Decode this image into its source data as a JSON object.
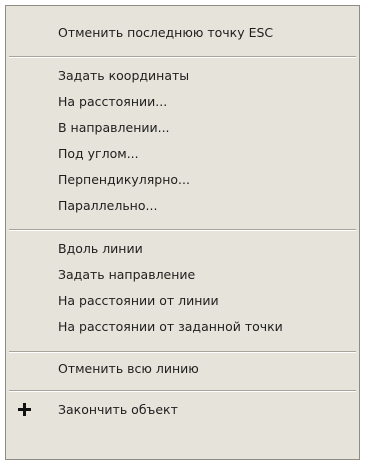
{
  "context_menu": {
    "items": [
      {
        "label": "Отменить последнюю точку ESC"
      },
      {
        "label": "Задать координаты"
      },
      {
        "label": "На расстоянии..."
      },
      {
        "label": "В направлении..."
      },
      {
        "label": "Под углом..."
      },
      {
        "label": "Перпендикулярно..."
      },
      {
        "label": "Параллельно..."
      },
      {
        "label": "Вдоль линии"
      },
      {
        "label": "Задать направление"
      },
      {
        "label": "На расстоянии от линии"
      },
      {
        "label": "На расстоянии от заданной точки"
      },
      {
        "label": "Отменить всю линию"
      },
      {
        "label": "Закончить объект",
        "icon": "plus-icon"
      }
    ]
  }
}
